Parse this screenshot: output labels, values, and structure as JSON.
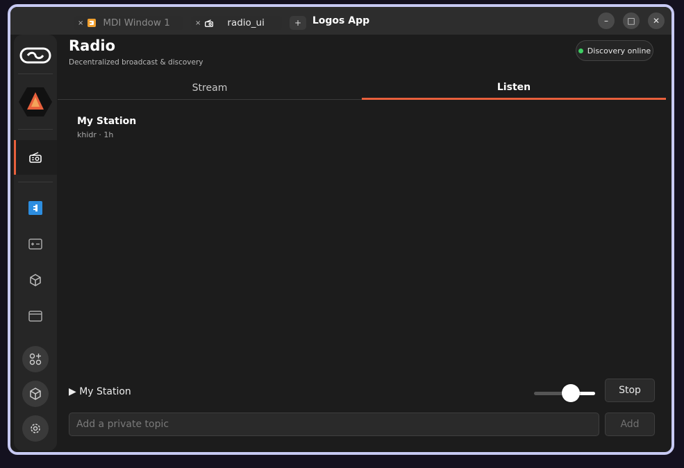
{
  "window": {
    "title": "Logos App",
    "minimize_glyph": "–",
    "maximize_glyph": "□",
    "close_glyph": "✕"
  },
  "sidebar": {
    "items": [
      {
        "icon": "logos-logo-icon"
      },
      {
        "icon": "app-triangle-icon"
      },
      {
        "icon": "radio-icon",
        "active": true
      },
      {
        "icon": "blue-square-icon"
      },
      {
        "icon": "terminal-icon"
      },
      {
        "icon": "package-icon"
      },
      {
        "icon": "browser-window-icon"
      },
      {
        "icon": "add-apps-icon"
      },
      {
        "icon": "package-icon"
      },
      {
        "icon": "settings-gear-icon"
      }
    ]
  },
  "tabs": [
    {
      "label": "MDI Window 1",
      "close": "×",
      "icon": "orange-window-icon"
    },
    {
      "label": "radio_ui",
      "close": "×",
      "icon": "radio-icon"
    },
    {
      "label": "+"
    }
  ],
  "header": {
    "title": "Radio",
    "subtitle": "Decentralized broadcast & discovery",
    "status": "Discovery online"
  },
  "segments": [
    {
      "label": "Stream",
      "active": false
    },
    {
      "label": "Listen",
      "active": true
    }
  ],
  "stations": [
    {
      "name": "My Station",
      "meta": "khidr · 1h"
    }
  ],
  "player": {
    "now_playing": "▶ My Station",
    "volume": 0.6,
    "stop_label": "Stop"
  },
  "topic": {
    "placeholder": "Add a private topic",
    "value": "",
    "add_label": "Add"
  },
  "colors": {
    "accent": "#e8603c",
    "status_online": "#3ecf63",
    "frame_border": "#c7c9f3"
  }
}
